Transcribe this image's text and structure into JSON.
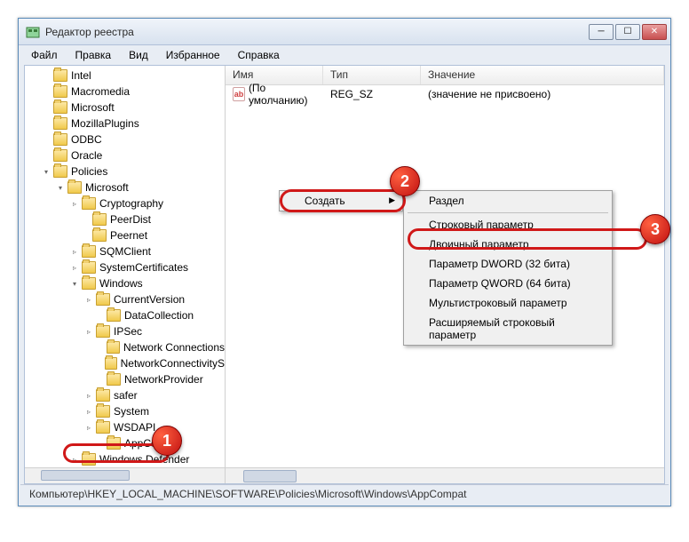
{
  "window": {
    "title": "Редактор реестра"
  },
  "menubar": [
    "Файл",
    "Правка",
    "Вид",
    "Избранное",
    "Справка"
  ],
  "tree": [
    {
      "label": "Intel",
      "indent": 18
    },
    {
      "label": "Macromedia",
      "indent": 18
    },
    {
      "label": "Microsoft",
      "indent": 18
    },
    {
      "label": "MozillaPlugins",
      "indent": 18
    },
    {
      "label": "ODBC",
      "indent": 18
    },
    {
      "label": "Oracle",
      "indent": 18
    },
    {
      "label": "Policies",
      "indent": 18,
      "expand": "▾"
    },
    {
      "label": "Microsoft",
      "indent": 34,
      "expand": "▾"
    },
    {
      "label": "Cryptography",
      "indent": 50,
      "expand": "▹"
    },
    {
      "label": "PeerDist",
      "indent": 62
    },
    {
      "label": "Peernet",
      "indent": 62
    },
    {
      "label": "SQMClient",
      "indent": 50,
      "expand": "▹"
    },
    {
      "label": "SystemCertificates",
      "indent": 50,
      "expand": "▹"
    },
    {
      "label": "Windows",
      "indent": 50,
      "expand": "▾"
    },
    {
      "label": "CurrentVersion",
      "indent": 66,
      "expand": "▹"
    },
    {
      "label": "DataCollection",
      "indent": 78
    },
    {
      "label": "IPSec",
      "indent": 66,
      "expand": "▹"
    },
    {
      "label": "Network Connections",
      "indent": 78
    },
    {
      "label": "NetworkConnectivityS",
      "indent": 78
    },
    {
      "label": "NetworkProvider",
      "indent": 78
    },
    {
      "label": "safer",
      "indent": 66,
      "expand": "▹"
    },
    {
      "label": "System",
      "indent": 66,
      "expand": "▹"
    },
    {
      "label": "WSDAPI",
      "indent": 66,
      "expand": "▹"
    },
    {
      "label": "AppCompat",
      "indent": 78,
      "selected": true
    },
    {
      "label": "Windows Defender",
      "indent": 50,
      "expand": "▹"
    }
  ],
  "list": {
    "headers": {
      "name": "Имя",
      "type": "Тип",
      "value": "Значение"
    },
    "rows": [
      {
        "icon": "ab",
        "name": "(По умолчанию)",
        "type": "REG_SZ",
        "value": "(значение не присвоено)"
      }
    ]
  },
  "context1": {
    "item": "Создать"
  },
  "context2": {
    "section": "Раздел",
    "items": [
      "Строковый параметр",
      "Двоичный параметр",
      "Параметр DWORD (32 бита)",
      "Параметр QWORD (64 бита)",
      "Мультистроковый параметр",
      "Расширяемый строковый параметр"
    ]
  },
  "statusbar": "Компьютер\\HKEY_LOCAL_MACHINE\\SOFTWARE\\Policies\\Microsoft\\Windows\\AppCompat",
  "badges": {
    "b1": "1",
    "b2": "2",
    "b3": "3"
  }
}
